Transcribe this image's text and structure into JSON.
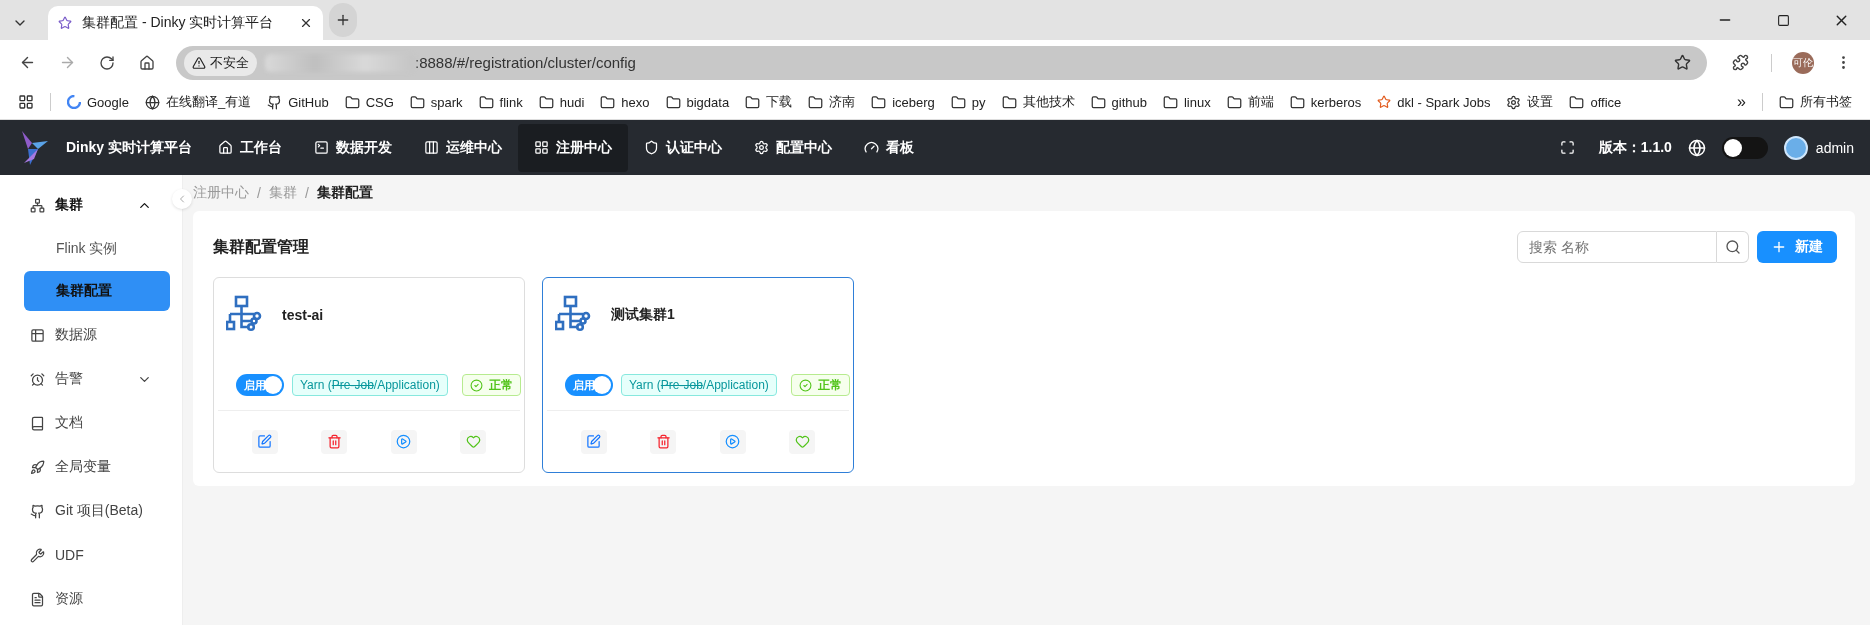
{
  "browser": {
    "tab": {
      "title": "集群配置 - Dinky 实时计算平台",
      "selected": true
    },
    "address": {
      "security": "不安全",
      "url": ":8888/#/registration/cluster/config"
    },
    "profile": "可伦",
    "bookmarks": [
      {
        "kind": "google",
        "label": "Google"
      },
      {
        "kind": "globe",
        "label": "在线翻译_有道"
      },
      {
        "kind": "github",
        "label": "GitHub"
      },
      {
        "kind": "folder",
        "label": "CSG"
      },
      {
        "kind": "folder",
        "label": "spark"
      },
      {
        "kind": "folder",
        "label": "flink"
      },
      {
        "kind": "folder",
        "label": "hudi"
      },
      {
        "kind": "folder",
        "label": "hexo"
      },
      {
        "kind": "folder",
        "label": "bigdata"
      },
      {
        "kind": "folder",
        "label": "下载"
      },
      {
        "kind": "folder",
        "label": "济南"
      },
      {
        "kind": "folder",
        "label": "iceberg"
      },
      {
        "kind": "folder",
        "label": "py"
      },
      {
        "kind": "folder",
        "label": "其他技术"
      },
      {
        "kind": "folder",
        "label": "github"
      },
      {
        "kind": "folder",
        "label": "linux"
      },
      {
        "kind": "folder",
        "label": "前端"
      },
      {
        "kind": "folder",
        "label": "kerberos"
      },
      {
        "kind": "spark",
        "label": "dkl - Spark Jobs"
      },
      {
        "kind": "gear",
        "label": "设置"
      },
      {
        "kind": "folder",
        "label": "office"
      }
    ],
    "more": "»",
    "all_bookmarks": "所有书签"
  },
  "app": {
    "brand": "Dinky 实时计算平台",
    "nav": [
      {
        "kind": "home",
        "label": "工作台",
        "selected": false
      },
      {
        "kind": "terminal",
        "label": "数据开发",
        "selected": false
      },
      {
        "kind": "ops",
        "label": "运维中心",
        "selected": false
      },
      {
        "kind": "grid",
        "label": "注册中心",
        "selected": true
      },
      {
        "kind": "shield",
        "label": "认证中心",
        "selected": false
      },
      {
        "kind": "gear",
        "label": "配置中心",
        "selected": false
      },
      {
        "kind": "gauge",
        "label": "看板",
        "selected": false
      }
    ],
    "version": "版本：1.1.0",
    "theme_switch": {
      "on": false
    },
    "user": "admin"
  },
  "sidebar": {
    "items": [
      {
        "kind": "cluster",
        "label": "集群",
        "expanded": true,
        "selected": false,
        "children": [
          {
            "label": "Flink 实例",
            "selected": false
          },
          {
            "label": "集群配置",
            "selected": true
          }
        ]
      },
      {
        "kind": "datasource",
        "label": "数据源",
        "selected": false
      },
      {
        "kind": "alarm",
        "label": "告警",
        "expanded": false,
        "selected": false
      },
      {
        "kind": "doc",
        "label": "文档",
        "selected": false
      },
      {
        "kind": "rocket",
        "label": "全局变量",
        "selected": false
      },
      {
        "kind": "github",
        "label": "Git 项目(Beta)",
        "selected": false
      },
      {
        "kind": "wrench",
        "label": "UDF",
        "selected": false
      },
      {
        "kind": "file",
        "label": "资源",
        "selected": false
      }
    ]
  },
  "breadcrumb": [
    {
      "label": "注册中心",
      "separator": "/"
    },
    {
      "label": "集群",
      "separator": "/"
    },
    {
      "label": "集群配置"
    }
  ],
  "panel": {
    "title": "集群配置管理",
    "search": {
      "placeholder": "搜索 名称"
    },
    "new_button": "新建",
    "cards": [
      {
        "name": "test-ai",
        "enabled": true,
        "switch_label": "启用",
        "type": {
          "prefix": "Yarn (",
          "struck": "Pre-Job",
          "suffix": "/Application)"
        },
        "status": "正常",
        "selected": false
      },
      {
        "name": "测试集群1",
        "enabled": true,
        "switch_label": "启用",
        "type": {
          "prefix": "Yarn (",
          "struck": "Pre-Job",
          "suffix": "/Application)"
        },
        "status": "正常",
        "selected": true
      }
    ]
  }
}
